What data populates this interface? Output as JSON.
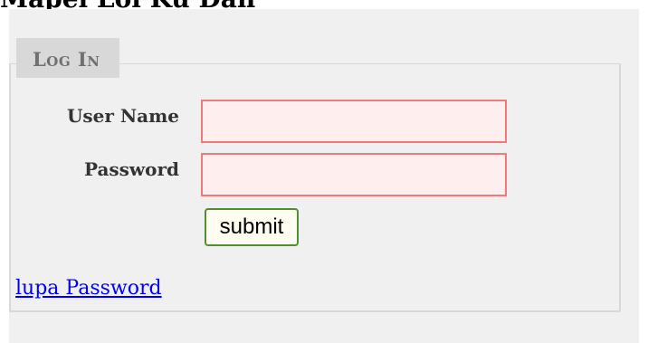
{
  "page": {
    "heading": "Mapel Loi Ku Dan"
  },
  "login": {
    "legend": "Log In",
    "username_label": "User Name",
    "username_value": "",
    "password_label": "Password",
    "password_value": "",
    "submit_label": "submit",
    "forgot_label": "lupa Password"
  },
  "colors": {
    "panel_bg": "#f0f0f0",
    "legend_bg": "#d8d8d8",
    "input_bg": "#ffeeee",
    "input_border": "#f07a7a",
    "button_border": "#4f8f2f",
    "link": "#0000ee"
  }
}
